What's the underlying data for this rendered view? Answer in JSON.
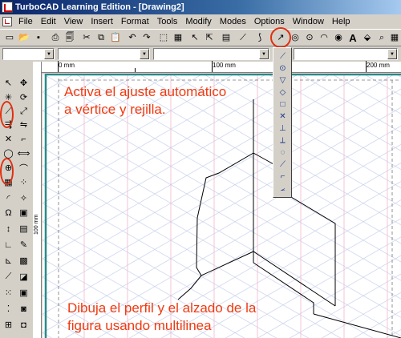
{
  "window": {
    "title": "TurboCAD Learning Edition - [Drawing2]"
  },
  "menu": [
    "File",
    "Edit",
    "View",
    "Insert",
    "Format",
    "Tools",
    "Modify",
    "Modes",
    "Options",
    "Window",
    "Help"
  ],
  "ruler": {
    "h_labels": [
      "0 mm",
      "100 mm",
      "200 mm"
    ],
    "v_label": "100 mm"
  },
  "captions": {
    "top_line1": "Activa el ajuste automático",
    "top_line2": "a vértice y rejilla.",
    "bottom_line1": "Dibuja el perfil y el alzado de la",
    "bottom_line2": "figura usando multilinea"
  },
  "colors": {
    "accent": "#f03a10",
    "title_bar": "#0a246a",
    "grid_blue": "#b8c4e8",
    "grid_pink": "#f0b0c8",
    "border_teal": "#2a8a8a"
  },
  "toolbar_icons": [
    "new-icon",
    "open-icon",
    "save-icon",
    "print-icon",
    "print-preview-icon",
    "cut-icon",
    "copy-icon",
    "paste-icon",
    "undo-icon",
    "redo-icon",
    "view-3d-icon",
    "select-icon",
    "select-edit-icon",
    "grid-icon",
    "snap-icon",
    "snap-vertex-icon",
    "snap-circle-icon",
    "snap-center-icon",
    "text-icon",
    "font-icon",
    "magnify-icon",
    "pan-icon"
  ],
  "flyout_icons": [
    "vertex-snap",
    "center-snap",
    "middle-snap",
    "quadrant-snap",
    "grid-snap",
    "intersection-snap",
    "perpendicular-snap",
    "tangent-snap",
    "arc-center-snap",
    "nearest-snap",
    "apparent-snap",
    "angle-snap"
  ]
}
